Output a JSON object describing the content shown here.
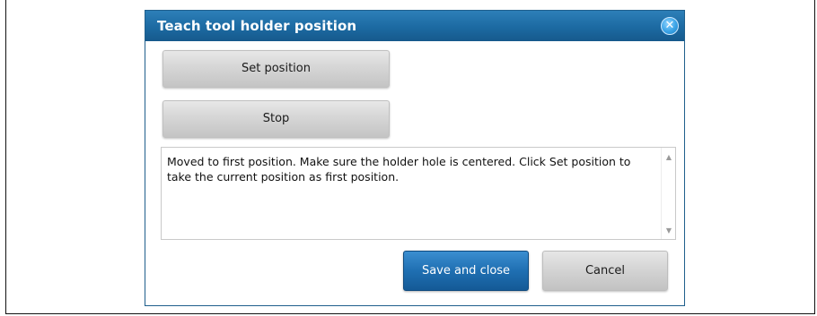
{
  "dialog": {
    "title": "Teach tool holder position",
    "close_icon": "close-icon",
    "close_glyph": "✕"
  },
  "buttons": {
    "set_position": "Set position",
    "stop": "Stop",
    "save_and_close": "Save and close",
    "cancel": "Cancel"
  },
  "message": {
    "text": "Moved to first position. Make sure the holder hole is centered. Click Set position to take the current position as first position."
  },
  "scrollbar": {
    "up_glyph": "▲",
    "down_glyph": "▼"
  },
  "colors": {
    "title_bar": "#1c6aa2",
    "primary_button": "#1f6fb2",
    "secondary_button": "#d3d3d3"
  }
}
